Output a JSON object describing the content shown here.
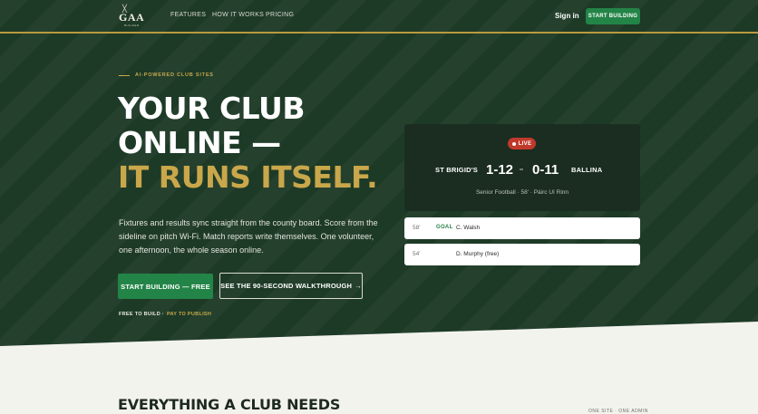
{
  "nav": {
    "logo_text": "GAA",
    "logo_subtext": "BUILDER",
    "links": [
      "FEATURES",
      "HOW IT WORKS",
      "PRICING"
    ],
    "sign_in": "Sign in",
    "cta": "START BUILDING"
  },
  "hero": {
    "eyebrow": "AI-POWERED CLUB SITES",
    "headline_line1": "YOUR CLUB",
    "headline_line2": "ONLINE —",
    "headline_line3": "IT RUNS ITSELF.",
    "lead": "Fixtures and results sync straight from the county board. Score from the sideline on pitch Wi-Fi. Match reports write themselves. One volunteer, one afternoon, the whole season online.",
    "primary_button": "START BUILDING — FREE",
    "secondary_button": "SEE THE 90-SECOND WALKTHROUGH",
    "secondary_button_arrow": "→",
    "fine_print_a": "FREE TO BUILD ·",
    "fine_print_b": "PAY TO PUBLISH"
  },
  "scorecard": {
    "status": "LIVE",
    "home_team": "ST BRIGID'S",
    "home_score": "1-12",
    "away_score": "0-11",
    "away_team": "BALLINA",
    "info": "Senior Football · 58' · Páirc Uí Rinn",
    "events": [
      {
        "minute": "58'",
        "type": "GOAL",
        "player": "C. Walsh"
      },
      {
        "minute": "54'",
        "type": "",
        "player": "D. Murphy (free)"
      }
    ]
  },
  "features": {
    "title": "EVERYTHING A CLUB NEEDS",
    "meta": "ONE SITE · ONE ADMIN"
  },
  "colors": {
    "hero_bg": "#1d3a26",
    "accent_green": "#238447",
    "accent_gold": "#c9a74a",
    "live_red": "#c0392b"
  }
}
